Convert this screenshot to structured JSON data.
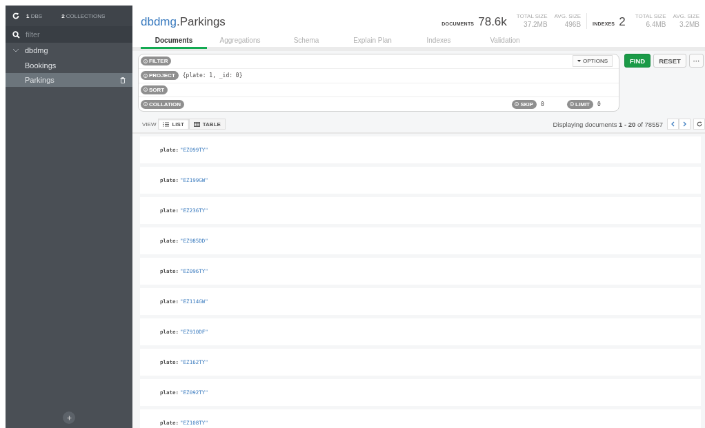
{
  "sidebar": {
    "dbs": "**1** DBS",
    "collections": "**2** COLLECTIONS",
    "filter": {
      "placeholder": "filter"
    },
    "tree": [
      {
        "label": "dbdmg",
        "expanded": true,
        "children": [
          {
            "label": "Bookings",
            "selected": false
          },
          {
            "label": "Parkings",
            "selected": true
          }
        ]
      }
    ]
  },
  "header": {
    "database": "dbdmg",
    "collection": ".Parkings",
    "stats": [
      {
        "label": "DOCUMENTS",
        "value": "78.6k",
        "details": [
          {
            "label": "TOTAL SIZE",
            "value": "37.2MB"
          },
          {
            "label": "AVG. SIZE",
            "value": "496B"
          }
        ]
      },
      {
        "label": "INDEXES",
        "value": "2",
        "details": [
          {
            "label": "TOTAL SIZE",
            "value": "6.4MB"
          },
          {
            "label": "AVG. SIZE",
            "value": "3.2MB"
          }
        ]
      }
    ]
  },
  "tabs": [
    {
      "label": "Documents",
      "selected": true
    },
    {
      "label": "Aggregations",
      "selected": false
    },
    {
      "label": "Schema",
      "selected": false
    },
    {
      "label": "Explain Plan",
      "selected": false
    },
    {
      "label": "Indexes",
      "selected": false
    },
    {
      "label": "Validation",
      "selected": false
    }
  ],
  "query": {
    "filter": {
      "label": "FILTER"
    },
    "project": {
      "label": "PROJECT",
      "value": "{plate: 1, _id: 0}"
    },
    "sort": {
      "label": "SORT"
    },
    "collation": {
      "label": "COLLATION"
    },
    "skip": {
      "label": "SKIP",
      "value": "0"
    },
    "limit": {
      "label": "LIMIT",
      "value": "0"
    },
    "options": "OPTIONS",
    "find": "FIND",
    "reset": "RESET",
    "more": "···"
  },
  "view": {
    "label": "VIEW",
    "modes": [
      {
        "label": "LIST",
        "selected": true
      },
      {
        "label": "TABLE",
        "selected": false
      }
    ],
    "paging": "Displaying documents **1 - 20** of 78557"
  },
  "documents": [
    {
      "key": "plate:",
      "value": "\"EZ099TY\""
    },
    {
      "key": "plate:",
      "value": "\"EZ199GW\""
    },
    {
      "key": "plate:",
      "value": "\"EZ236TY\""
    },
    {
      "key": "plate:",
      "value": "\"EZ985DD\""
    },
    {
      "key": "plate:",
      "value": "\"EZ096TY\""
    },
    {
      "key": "plate:",
      "value": "\"EZ114GW\""
    },
    {
      "key": "plate:",
      "value": "\"EZ910DF\""
    },
    {
      "key": "plate:",
      "value": "\"EZ162TY\""
    },
    {
      "key": "plate:",
      "value": "\"EZ092TY\""
    },
    {
      "key": "plate:",
      "value": "\"EZ108TY\""
    }
  ]
}
